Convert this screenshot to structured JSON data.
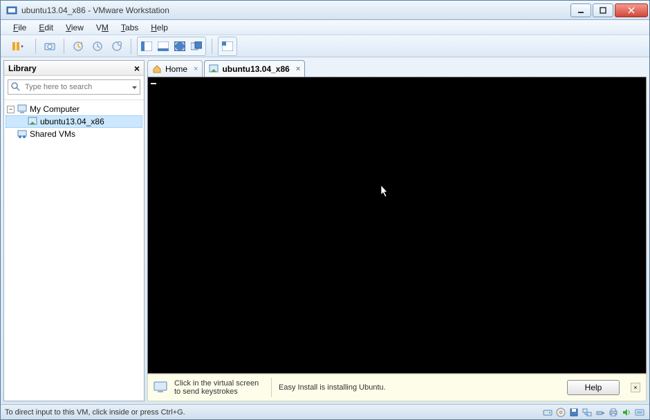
{
  "window": {
    "title": "ubuntu13.04_x86 - VMware Workstation"
  },
  "menubar": {
    "items": [
      {
        "text": "File",
        "u": "F"
      },
      {
        "text": "Edit",
        "u": "E"
      },
      {
        "text": "View",
        "u": "V"
      },
      {
        "text": "VM",
        "u": "M"
      },
      {
        "text": "Tabs",
        "u": "T"
      },
      {
        "text": "Help",
        "u": "H"
      }
    ]
  },
  "library": {
    "title": "Library",
    "search_placeholder": "Type here to search",
    "tree": {
      "root": {
        "label": "My Computer"
      },
      "vm": {
        "label": "ubuntu13.04_x86"
      },
      "shared": {
        "label": "Shared VMs"
      }
    }
  },
  "tabs": {
    "home": {
      "label": "Home"
    },
    "vm": {
      "label": "ubuntu13.04_x86"
    }
  },
  "infobar": {
    "hint": "Click in the virtual screen to send keystrokes",
    "status": "Easy Install is installing Ubuntu.",
    "help": "Help"
  },
  "statusbar": {
    "text": "To direct input to this VM, click inside or press Ctrl+G."
  }
}
